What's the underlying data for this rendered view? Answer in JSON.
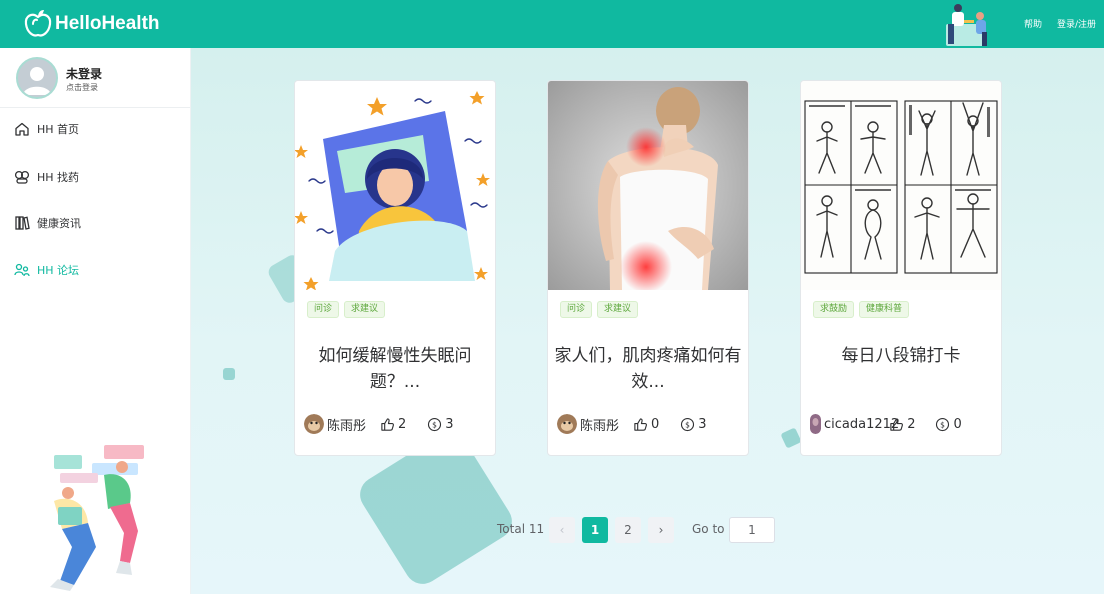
{
  "header": {
    "app_name": "HelloHealth",
    "help_label": "帮助",
    "login_label": "登录/注册"
  },
  "user": {
    "name": "未登录",
    "sub": "点击登录"
  },
  "sidebar": {
    "items": [
      {
        "label": "HH 首页",
        "icon": "home-icon",
        "active": false
      },
      {
        "label": "HH 找药",
        "icon": "pills-icon",
        "active": false
      },
      {
        "label": "健康资讯",
        "icon": "books-icon",
        "active": false
      },
      {
        "label": "HH 论坛",
        "icon": "forum-icon",
        "active": true
      }
    ]
  },
  "cards": [
    {
      "tags": [
        "问诊",
        "求建议"
      ],
      "title": "如何缓解慢性失眠问题？...",
      "author": "陈雨彤",
      "likes": "2",
      "coins": "3",
      "image": "insomnia-illustration"
    },
    {
      "tags": [
        "问诊",
        "求建议"
      ],
      "title": "家人们，肌肉疼痛如何有效...",
      "author": "陈雨彤",
      "likes": "0",
      "coins": "3",
      "image": "back-pain-photo"
    },
    {
      "tags": [
        "求鼓励",
        "健康科普"
      ],
      "title": "每日八段锦打卡",
      "author": "cicada1212",
      "likes": "2",
      "coins": "0",
      "image": "baduanjin-sketch"
    }
  ],
  "pagination": {
    "total_label": "Total 11",
    "prev": "‹",
    "next": "›",
    "pages": [
      "1",
      "2"
    ],
    "current": "1",
    "goto_label": "Go to",
    "goto_value": "1"
  },
  "colors": {
    "brand": "#10b9a0",
    "tag_text": "#5ea83d",
    "tag_bg": "#eef8e8"
  }
}
